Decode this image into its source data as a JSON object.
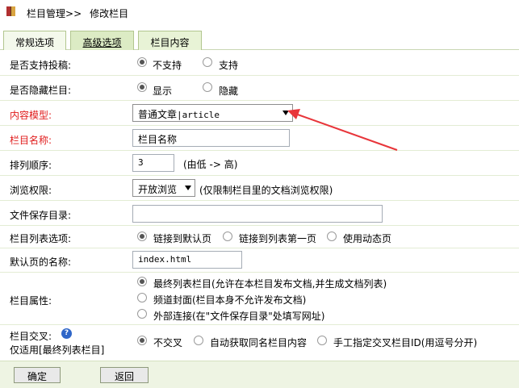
{
  "breadcrumb": {
    "root": "栏目管理",
    "separator": ">>",
    "current": "修改栏目"
  },
  "tabs": [
    {
      "label": "常规选项"
    },
    {
      "label": "高级选项"
    },
    {
      "label": "栏目内容"
    }
  ],
  "form": {
    "allow_submit": {
      "label": "是否支持投稿:",
      "options": [
        "不支持",
        "支持"
      ],
      "selected": "不支持"
    },
    "hidden": {
      "label": "是否隐藏栏目:",
      "options": [
        "显示",
        "隐藏"
      ],
      "selected": "显示"
    },
    "content_model": {
      "label": "内容模型:",
      "value_cn": "普通文章",
      "value_sep": "|",
      "value_en": "article"
    },
    "column_name": {
      "label": "栏目名称:",
      "value": "栏目名称"
    },
    "sort_order": {
      "label": "排列顺序:",
      "value": "3",
      "hint": "(由低 -> 高)"
    },
    "browse_perm": {
      "label": "浏览权限:",
      "value": "开放浏览",
      "hint": "(仅限制栏目里的文档浏览权限)"
    },
    "save_dir": {
      "label": "文件保存目录:",
      "value": ""
    },
    "list_option": {
      "label": "栏目列表选项:",
      "options": [
        "链接到默认页",
        "链接到列表第一页",
        "使用动态页"
      ],
      "selected": "链接到默认页"
    },
    "default_page": {
      "label": "默认页的名称:",
      "value": "index.html"
    },
    "attribute": {
      "label": "栏目属性:",
      "options": [
        "最终列表栏目(允许在本栏目发布文档,并生成文档列表)",
        "频道封面(栏目本身不允许发布文档)",
        "外部连接(在\"文件保存目录\"处填写网址)"
      ],
      "selected": "最终列表栏目(允许在本栏目发布文档,并生成文档列表)"
    },
    "cross": {
      "label": "栏目交叉:",
      "sublabel": "仅适用[最终列表栏目]",
      "options": [
        "不交叉",
        "自动获取同名栏目内容",
        "手工指定交叉栏目ID(用逗号分开)"
      ],
      "selected": "不交叉"
    }
  },
  "buttons": {
    "confirm": "确定",
    "back": "返回"
  },
  "colors": {
    "required_label": "#e01b1b",
    "annotation_arrow": "#e8353a",
    "tab_bg": "#e8f3d6",
    "footer_bg": "#eef4e3"
  }
}
